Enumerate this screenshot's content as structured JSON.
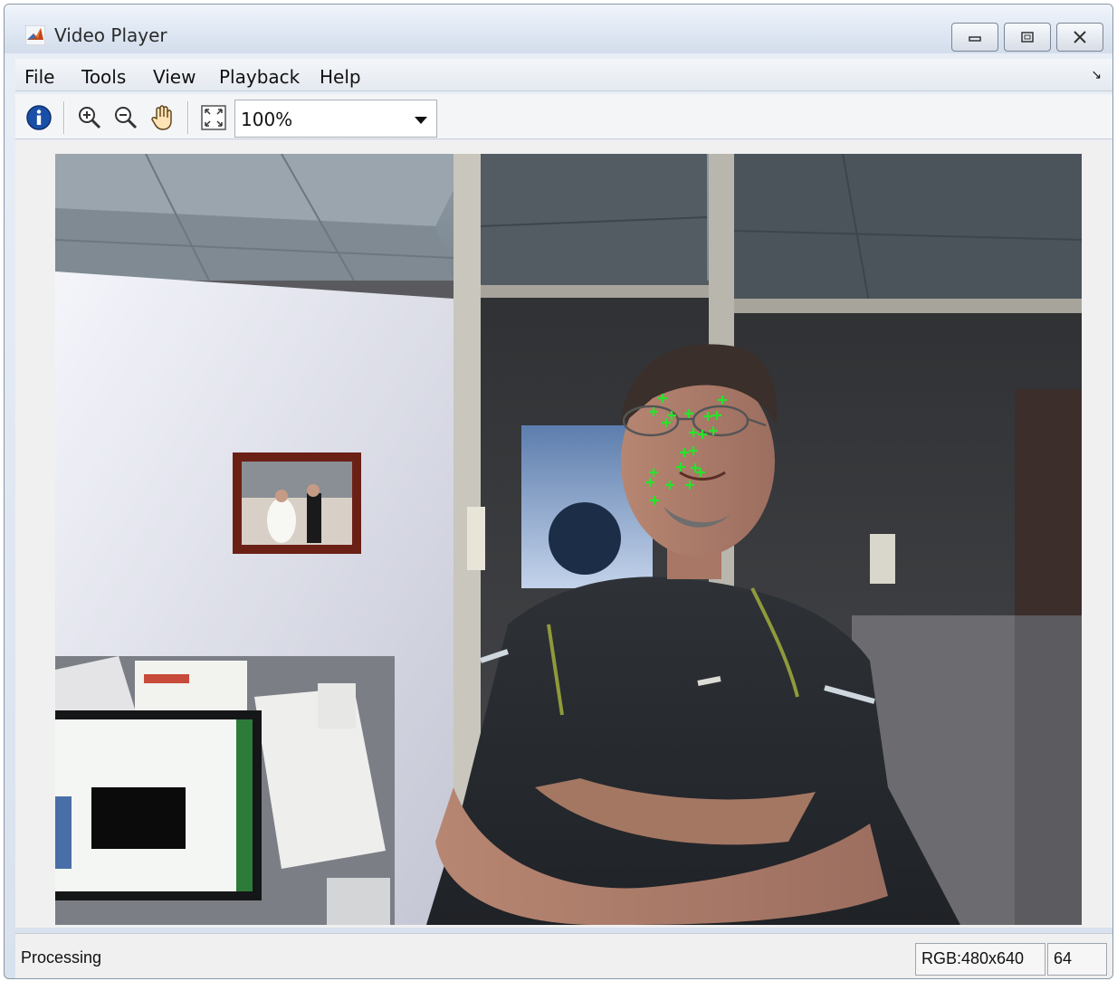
{
  "window": {
    "title": "Video Player",
    "minimize_icon": "minimize-icon",
    "restore_icon": "restore-icon",
    "close_icon": "close-icon"
  },
  "menubar": {
    "items": [
      {
        "label": "File"
      },
      {
        "label": "Tools"
      },
      {
        "label": "View"
      },
      {
        "label": "Playback"
      },
      {
        "label": "Help"
      }
    ],
    "undock_icon": "undock-arrow-icon"
  },
  "toolbar": {
    "info_icon": "info-icon",
    "zoom_in_icon": "zoom-in-icon",
    "zoom_out_icon": "zoom-out-icon",
    "pan_icon": "pan-hand-icon",
    "fit_icon": "fit-to-window-icon",
    "zoom_level": "100%"
  },
  "video": {
    "description_icon": "video-frame",
    "marker_color": "#27e32b"
  },
  "statusbar": {
    "status": "Processing",
    "format": "RGB:480x640",
    "frame": "64"
  },
  "colors": {
    "titlebar": "#dde6f2",
    "marker": "#27e32b",
    "info_blue": "#1a4fa8"
  }
}
